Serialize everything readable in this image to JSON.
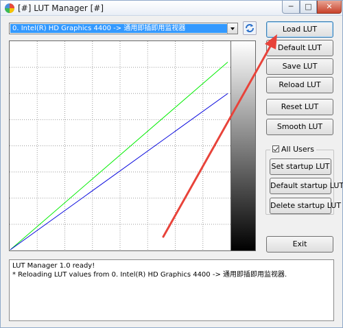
{
  "window": {
    "title": "[#] LUT Manager [#]",
    "controls": {
      "minimize": "─",
      "maximize": "□",
      "close": "✕"
    }
  },
  "device": {
    "selected": "0. Intel(R) HD Graphics 4400 -> 通用即插即用监视器"
  },
  "buttons": {
    "load_lut": "Load LUT",
    "default_lut": "Default LUT",
    "save_lut": "Save LUT",
    "reload_lut": "Reload LUT",
    "reset_lut": "Reset LUT",
    "smooth_lut": "Smooth LUT",
    "exit": "Exit"
  },
  "all_users": {
    "label": "All Users",
    "checked": true,
    "set_startup": "Set startup LUT",
    "default_startup": "Default startup LUT",
    "delete_startup": "Delete startup LUT"
  },
  "log": {
    "lines": [
      "LUT Manager 1.0 ready!",
      "* Reloading LUT values from 0. Intel(R) HD Graphics 4400 -> 通用即插即用监视器."
    ]
  },
  "curves": {
    "grid_divisions": 8,
    "series": [
      {
        "color": "#00ee00",
        "end_level": 0.9
      },
      {
        "color": "#0000dd",
        "end_level": 0.75
      }
    ]
  },
  "annotation_color": "#e8433a"
}
